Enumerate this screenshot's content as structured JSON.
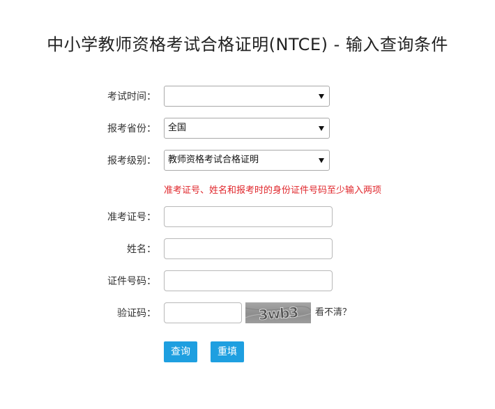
{
  "title": "中小学教师资格考试合格证明(NTCE) - 输入查询条件",
  "form": {
    "exam_time": {
      "label": "考试时间：",
      "value": ""
    },
    "province": {
      "label": "报考省份：",
      "value": "全国"
    },
    "level": {
      "label": "报考级别：",
      "value": "教师资格考试合格证明"
    },
    "hint": "准考证号、姓名和报考时的身份证件号码至少输入两项",
    "ticket_no": {
      "label": "准考证号：",
      "value": ""
    },
    "name": {
      "label": "姓名：",
      "value": ""
    },
    "id_no": {
      "label": "证件号码：",
      "value": ""
    },
    "captcha": {
      "label": "验证码：",
      "value": "",
      "image_text": "3wb3",
      "refresh_label": "看不清？"
    }
  },
  "buttons": {
    "query_label": "查询",
    "reset_label": "重填"
  },
  "colors": {
    "accent": "#1e9fe0",
    "hint": "#e0262b"
  },
  "icons": {
    "select_arrow": "chevron-down-icon"
  }
}
